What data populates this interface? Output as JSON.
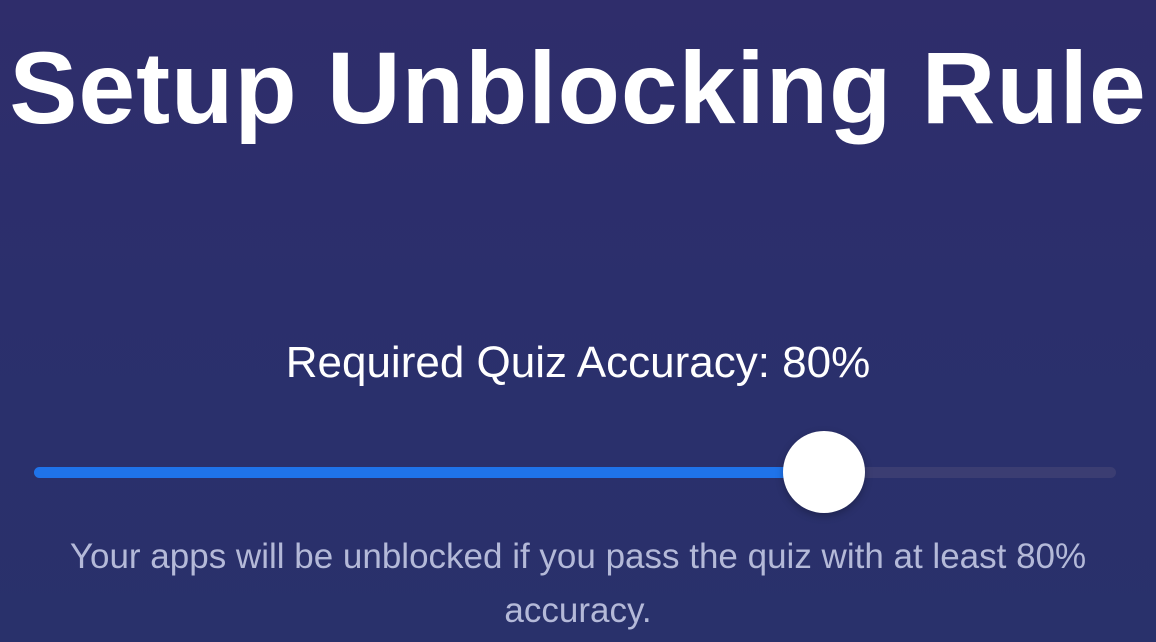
{
  "screen": {
    "title": "Setup Unblocking Rule",
    "accuracy_label": "Required Quiz Accuracy: 80%",
    "slider": {
      "value_fraction": 0.73,
      "fill_color": "#1f73ea",
      "track_color": "#3b3d72",
      "thumb_color": "#ffffff"
    },
    "description": "Your apps will be unblocked if you pass the quiz with at least 80% accuracy."
  },
  "colors": {
    "background": "#2c2f6b",
    "text_primary": "#ffffff",
    "text_secondary": "#b4b9d8"
  }
}
